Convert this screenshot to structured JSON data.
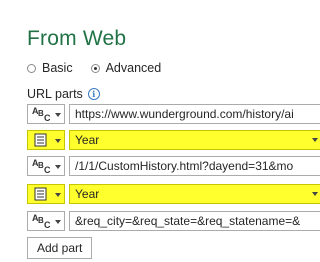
{
  "title": "From Web",
  "mode": {
    "options": [
      {
        "label": "Basic",
        "selected": false
      },
      {
        "label": "Advanced",
        "selected": true
      }
    ]
  },
  "url_parts": {
    "label": "URL parts",
    "info_icon": "info-icon",
    "rows": [
      {
        "kind": "text",
        "type_icon": "abc-text-icon",
        "value": "https://www.wunderground.com/history/ai"
      },
      {
        "kind": "parameter",
        "type_icon": "parameter-icon",
        "value": "Year",
        "highlight": "#ffff2e"
      },
      {
        "kind": "text",
        "type_icon": "abc-text-icon",
        "value": "/1/1/CustomHistory.html?dayend=31&mo"
      },
      {
        "kind": "parameter",
        "type_icon": "parameter-icon",
        "value": "Year",
        "highlight": "#ffff2e"
      },
      {
        "kind": "text",
        "type_icon": "abc-text-icon",
        "value": "&req_city=&req_state=&req_statename=&"
      }
    ]
  },
  "add_part_label": "Add part",
  "colors": {
    "title": "#217346",
    "highlight": "#ffff2e",
    "border": "#ababab"
  }
}
